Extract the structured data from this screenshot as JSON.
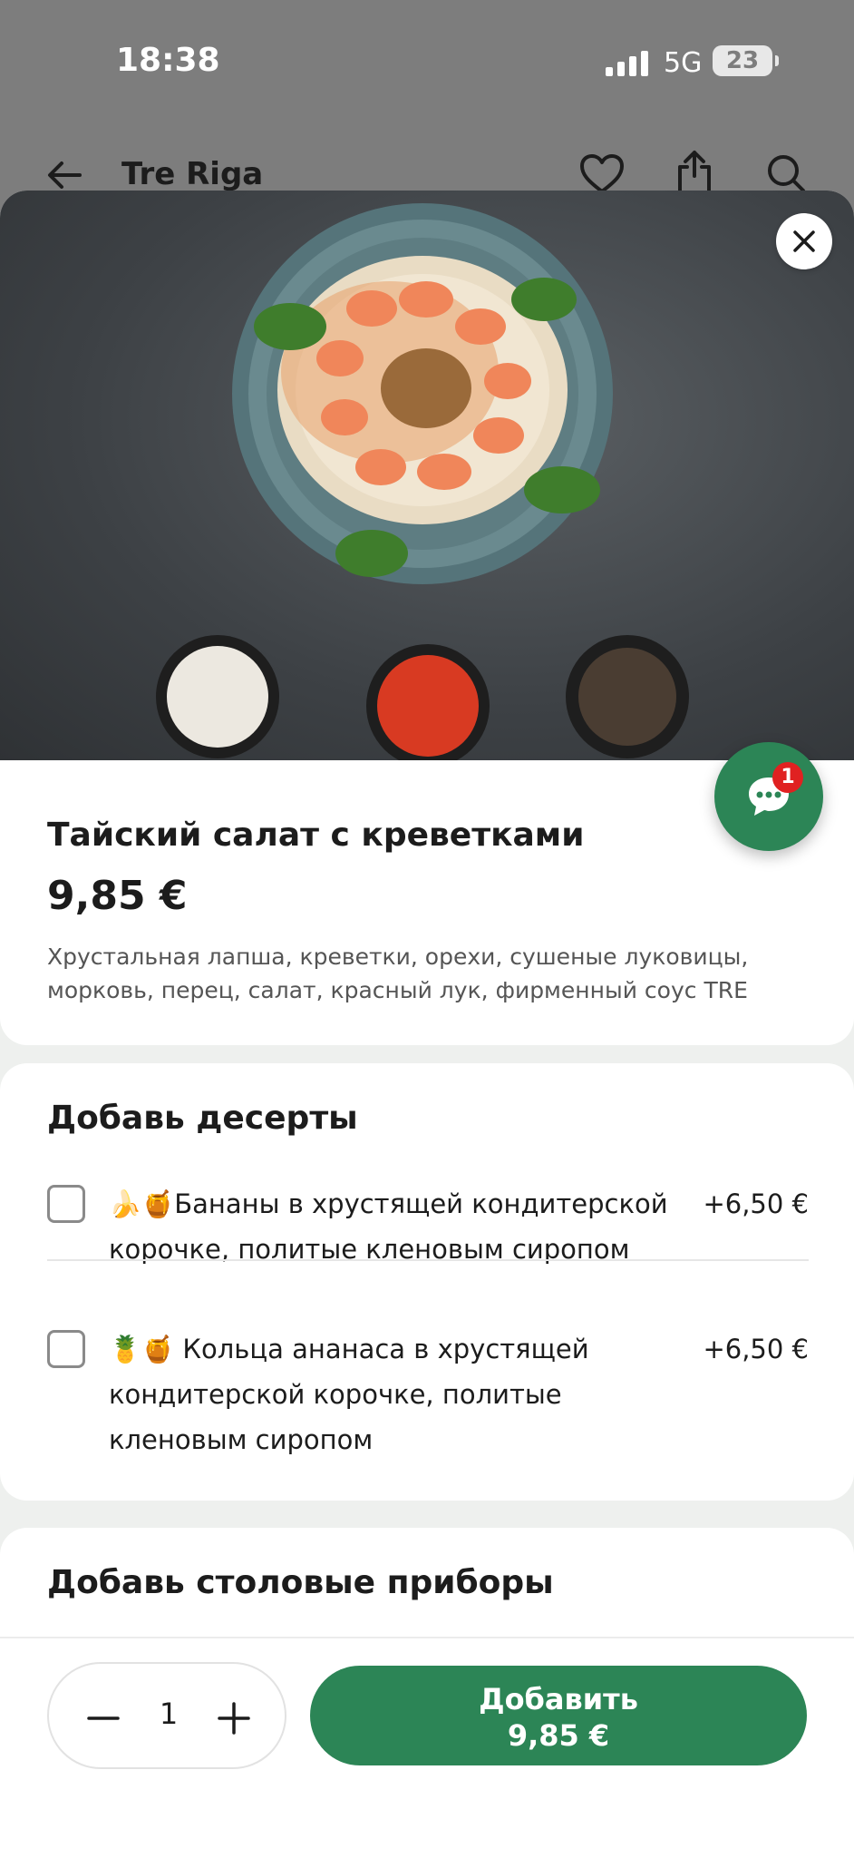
{
  "status_bar": {
    "time": "18:38",
    "network": "5G",
    "battery": "23"
  },
  "nav": {
    "title": "Tre Riga"
  },
  "product": {
    "name": "Тайский салат с креветками",
    "price": "9,85 €",
    "description": "Хрустальная лапша, креветки, орехи, сушеные луковицы, морковь, перец, салат, красный лук, фирменный соус TRE"
  },
  "chat": {
    "badge": "1"
  },
  "desserts": {
    "heading": "Добавь десерты",
    "options": [
      {
        "label": "🍌🍯Бананы в хрустящей кондитерской корочке, политые кленовым сиропом",
        "price": "+6,50 €"
      },
      {
        "label": "🍍🍯 Кольца ананаса в хрустящей кондитерской корочке, политые кленовым сиропом",
        "price": "+6,50 €"
      }
    ]
  },
  "cutlery": {
    "heading": "Добавь столовые приборы"
  },
  "cart": {
    "quantity": "1",
    "add_label": "Добавить",
    "add_price": "9,85 €"
  },
  "colors": {
    "accent": "#2c8556",
    "badge": "#e02121"
  }
}
